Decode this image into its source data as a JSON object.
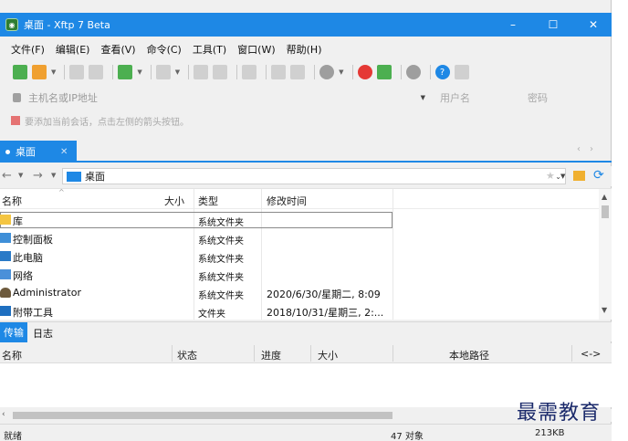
{
  "window": {
    "title": "桌面 - Xftp 7 Beta",
    "controls": {
      "minimize": "–",
      "maximize": "☐",
      "close": "✕"
    }
  },
  "menu": [
    "文件(F)",
    "编辑(E)",
    "查看(V)",
    "命令(C)",
    "工具(T)",
    "窗口(W)",
    "帮助(H)"
  ],
  "connection": {
    "host_placeholder": "主机名或IP地址",
    "username_placeholder": "用户名",
    "password_placeholder": "密码"
  },
  "hint": "要添加当前会话，点击左侧的箭头按钮。",
  "session_tabs": [
    {
      "label": "桌面",
      "active": true
    }
  ],
  "path": {
    "value": "桌面"
  },
  "file_list": {
    "columns": [
      "名称",
      "大小",
      "类型",
      "修改时间"
    ],
    "rows": [
      {
        "name": "库",
        "type": "系统文件夹",
        "modified": "",
        "icon": "library-icon"
      },
      {
        "name": "控制面板",
        "type": "系统文件夹",
        "modified": "",
        "icon": "control-panel-icon"
      },
      {
        "name": "此电脑",
        "type": "系统文件夹",
        "modified": "",
        "icon": "computer-icon"
      },
      {
        "name": "网络",
        "type": "系统文件夹",
        "modified": "",
        "icon": "network-icon"
      },
      {
        "name": "Administrator",
        "type": "系统文件夹",
        "modified": "2020/6/30/星期二, 8:09",
        "icon": "user-icon"
      },
      {
        "name": "附带工具",
        "type": "文件夹",
        "modified": "2018/10/31/星期三, 2:...",
        "icon": "tools-icon"
      }
    ]
  },
  "transfer": {
    "tabs": [
      "传输",
      "日志"
    ],
    "columns": [
      "名称",
      "状态",
      "进度",
      "大小",
      "本地路径",
      "<->"
    ]
  },
  "status": {
    "ready": "就绪",
    "count": "47 对象",
    "size": "213KB"
  },
  "watermark": "最需教育",
  "colors": {
    "accent": "#1e88e5",
    "title_bar": "#1e88e5",
    "watermark": "#1b2a6b"
  }
}
